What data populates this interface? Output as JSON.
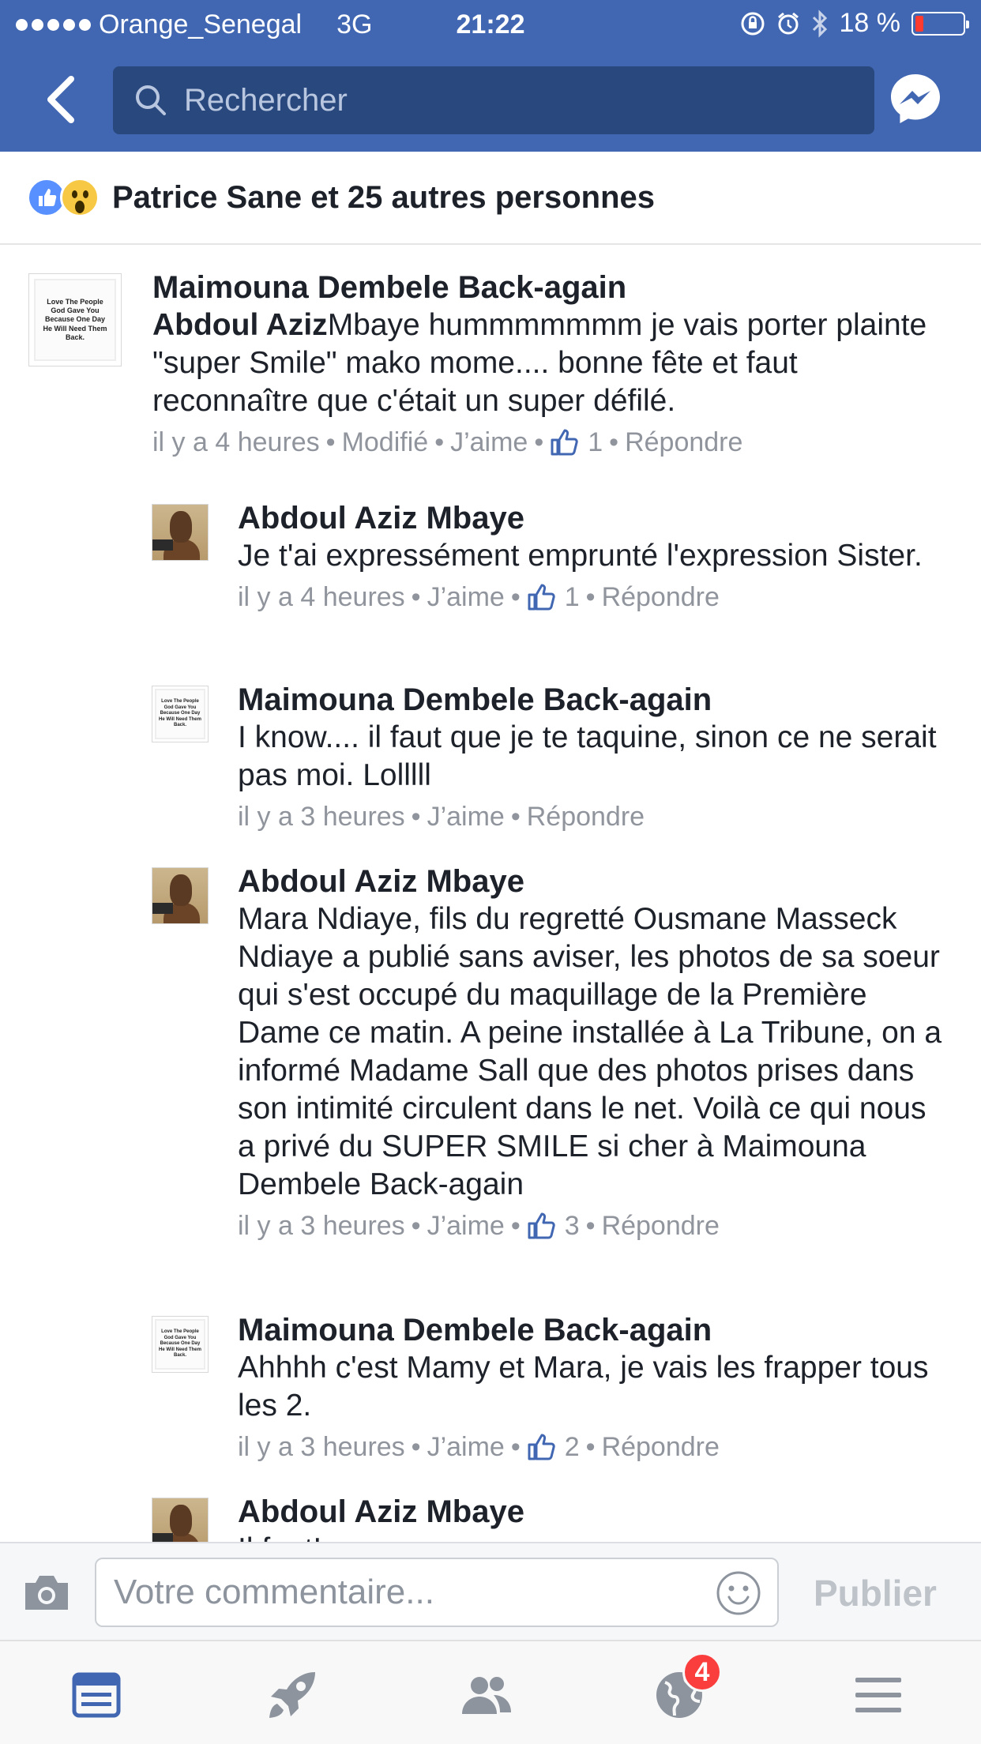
{
  "status_bar": {
    "carrier": "Orange_Senegal",
    "network": "3G",
    "time": "21:22",
    "battery": "18 %",
    "battery_level": 0.18
  },
  "header": {
    "search_placeholder": "Rechercher"
  },
  "reactions_summary": {
    "text": "Patrice Sane et 25 autres personnes"
  },
  "quote_avatar_text": "Love The People God Gave You Because One Day He Will Need Them Back.",
  "comments": [
    {
      "author": "Maimouna Dembele Back-again",
      "mention": "Abdoul Aziz",
      "text": "Mbaye hummmmmmm je vais porter plainte \"super Smile\" mako mome.... bonne fête et faut reconnaître que c'était un super défilé.",
      "time": "il y a 4 heures",
      "edited": "Modifié",
      "like_label": "J’aime",
      "like_count": "1",
      "reply_label": "Répondre"
    },
    {
      "author": "Abdoul Aziz Mbaye",
      "text": "Je t'ai expressément emprunté l'expression Sister.",
      "time": "il y a 4 heures",
      "like_label": "J’aime",
      "like_count": "1",
      "reply_label": "Répondre"
    },
    {
      "author": "Maimouna Dembele Back-again",
      "text": "I know.... il faut que je te taquine, sinon ce ne serait pas moi. Lolllll",
      "time": "il y a 3 heures",
      "like_label": "J’aime",
      "reply_label": "Répondre"
    },
    {
      "author": "Abdoul Aziz Mbaye",
      "text": "Mara Ndiaye, fils du regretté Ousmane Masseck Ndiaye a publié sans aviser, les photos de sa soeur qui s'est occupé du maquillage de la Première Dame ce matin. A peine installée à La Tribune, on a informé Madame Sall que des photos prises dans son intimité circulent dans le net. Voilà ce qui nous a privé du SUPER SMILE si cher à Maimouna Dembele Back-again",
      "time": "il y a 3 heures",
      "like_label": "J’aime",
      "like_count": "3",
      "reply_label": "Répondre"
    },
    {
      "author": "Maimouna Dembele Back-again",
      "text": "Ahhhh c'est Mamy et Mara, je vais les frapper tous les 2.",
      "time": "il y a 3 heures",
      "like_label": "J’aime",
      "like_count": "2",
      "reply_label": "Répondre"
    },
    {
      "author": "Abdoul Aziz Mbaye",
      "text": "Il faut!"
    }
  ],
  "composer": {
    "placeholder": "Votre commentaire...",
    "publish_label": "Publier"
  },
  "tabbar": {
    "notifications_badge": "4"
  },
  "colors": {
    "brand_blue": "#4267b2",
    "search_bg": "#29487d",
    "meta_gray": "#90949c",
    "badge_red": "#fa3e3e",
    "tab_active": "#4267b2",
    "tab_inactive": "#8d949e"
  },
  "icons": [
    "back-chevron-icon",
    "search-icon",
    "messenger-icon",
    "like-reaction-icon",
    "wow-reaction-icon",
    "thumbs-up-icon",
    "camera-icon",
    "smiley-icon",
    "news-feed-icon",
    "rocket-icon",
    "friends-icon",
    "globe-icon",
    "menu-icon"
  ]
}
